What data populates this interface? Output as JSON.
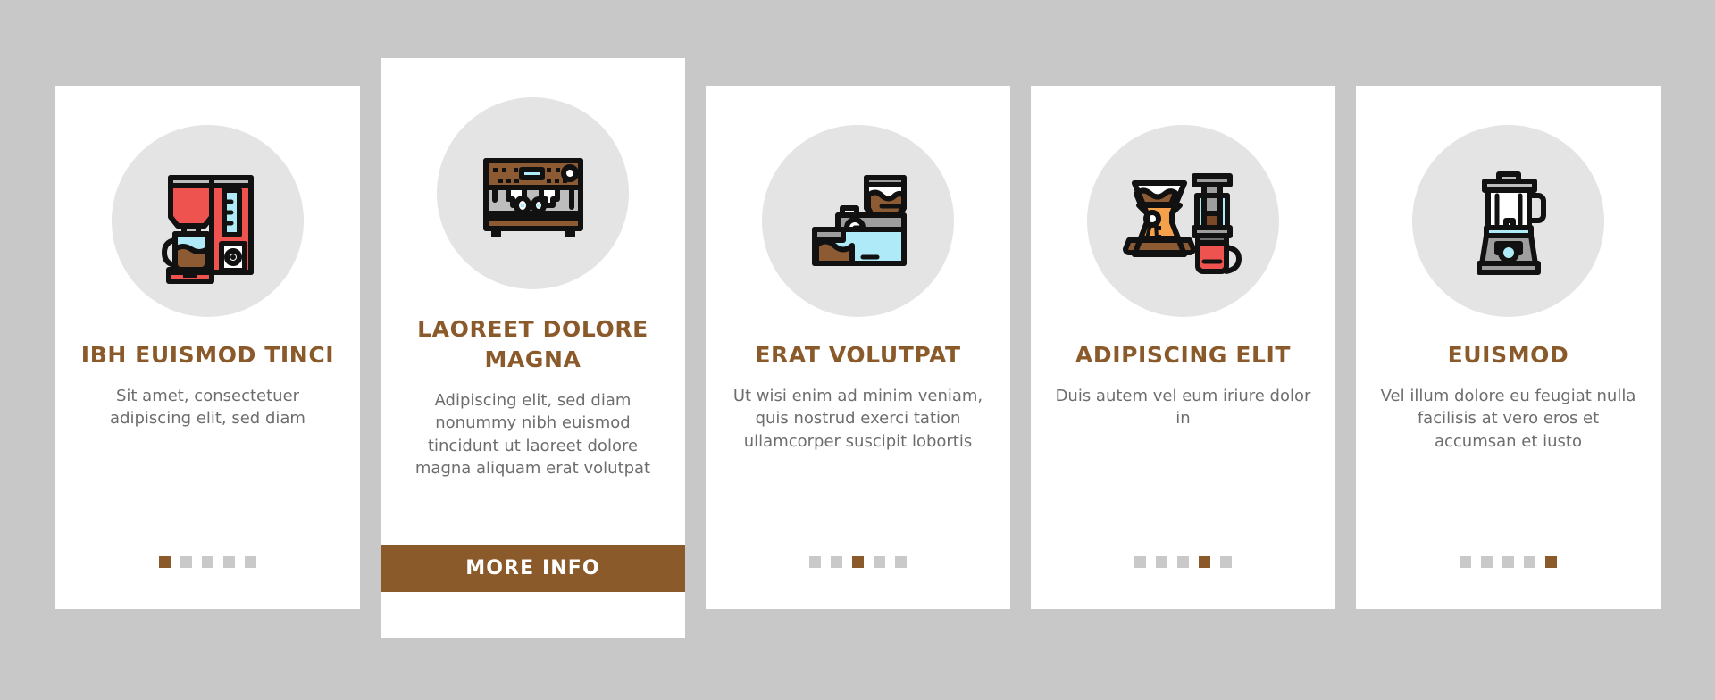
{
  "background_color": "#c8c8c8",
  "theme": {
    "card_bg": "#ffffff",
    "icon_blob": "#e4e4e4",
    "accent": "#8a5a2b",
    "body_text": "#6d6d6d",
    "dot_inactive": "#c9c9c9"
  },
  "cards": [
    {
      "icon": "drip-coffee-maker-icon",
      "title": "IBH EUISMOD TINCI",
      "body": "Sit amet, consectetuer adipiscing elit, sed diam",
      "dots": {
        "count": 5,
        "active": 1
      },
      "cta": null
    },
    {
      "icon": "espresso-machine-icon",
      "title": "LAOREET DOLORE MAGNA",
      "body": "Adipiscing elit, sed diam nonummy nibh euismod tincidunt ut laoreet dolore magna aliquam erat volutpat",
      "dots": null,
      "cta": "MORE INFO"
    },
    {
      "icon": "coffee-grinder-icon",
      "title": "ERAT VOLUTPAT",
      "body": "Ut wisi enim ad minim veniam, quis nostrud exerci tation ullamcorper suscipit lobortis",
      "dots": {
        "count": 5,
        "active": 3
      },
      "cta": null
    },
    {
      "icon": "pour-over-aeropress-icon",
      "title": "ADIPISCING ELIT",
      "body": "Duis autem vel eum iriure dolor in",
      "dots": {
        "count": 5,
        "active": 4
      },
      "cta": null
    },
    {
      "icon": "blender-icon",
      "title": "EUISMOD",
      "body": "Vel illum dolore eu feugiat nulla facilisis at vero eros et accumsan et iusto",
      "dots": {
        "count": 5,
        "active": 5
      },
      "cta": null
    }
  ]
}
